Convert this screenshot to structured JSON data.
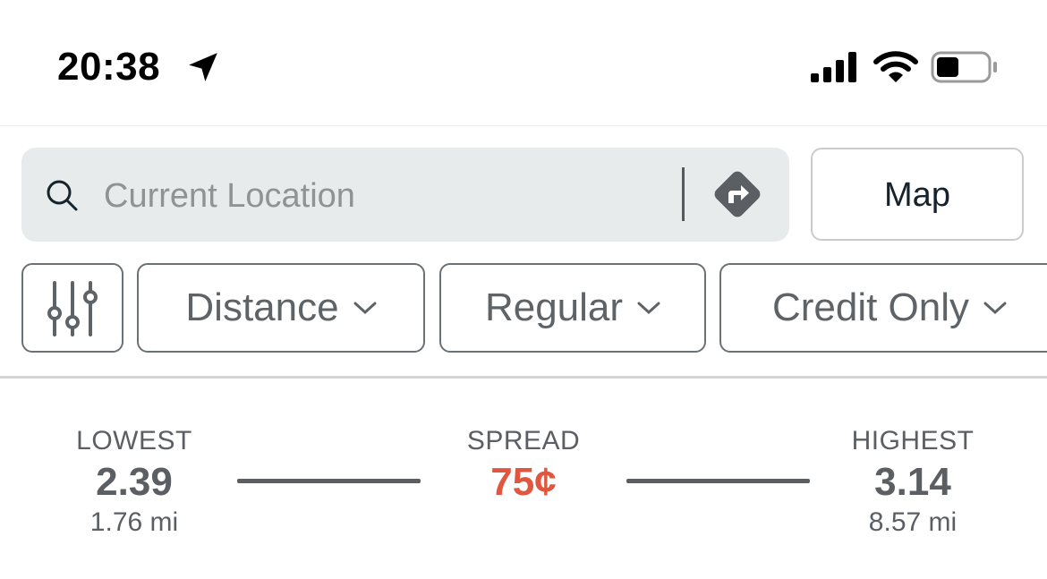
{
  "status_bar": {
    "time": "20:38",
    "icons": [
      "location-arrow-icon",
      "cellular-signal-icon",
      "wifi-icon",
      "battery-icon"
    ]
  },
  "search": {
    "placeholder": "Current Location",
    "value": "",
    "icon": "search-icon",
    "action_icon": "directions-icon"
  },
  "map_button": {
    "label": "Map"
  },
  "filters": {
    "settings_icon": "sliders-icon",
    "chips": [
      {
        "label": "Distance"
      },
      {
        "label": "Regular"
      },
      {
        "label": "Credit Only"
      }
    ]
  },
  "price_summary": {
    "lowest": {
      "label": "LOWEST",
      "price": "2.39",
      "distance": "1.76 mi"
    },
    "spread": {
      "label": "SPREAD",
      "value": "75¢"
    },
    "highest": {
      "label": "HIGHEST",
      "price": "3.14",
      "distance": "8.57 mi"
    }
  },
  "colors": {
    "search_bg": "#e7ebec",
    "spread_accent": "#e0563f",
    "text_gray": "#5b5f63",
    "border_gray": "#6c7175"
  }
}
